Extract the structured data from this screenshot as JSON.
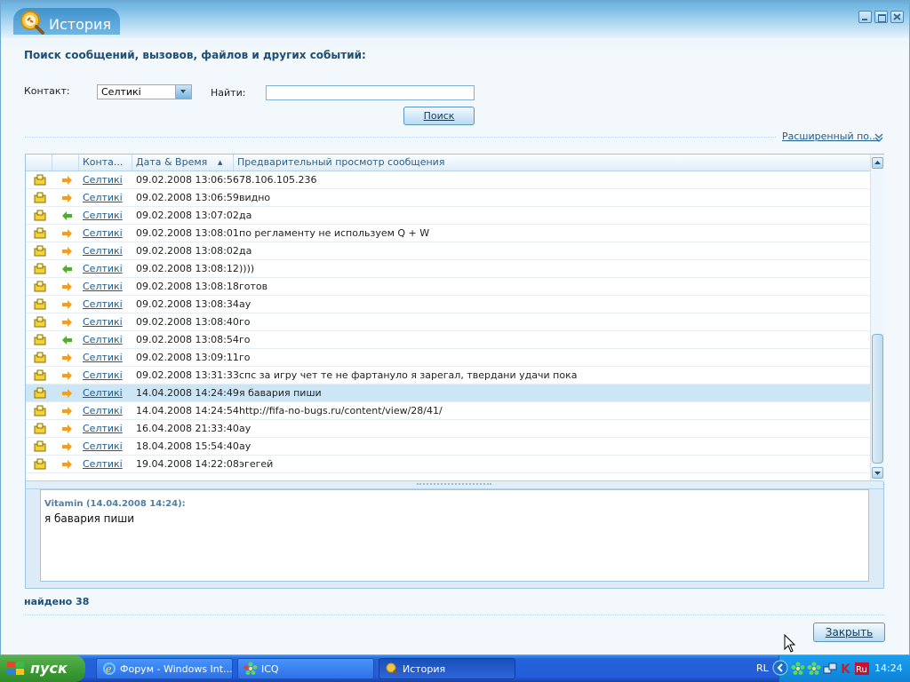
{
  "window": {
    "title": "История",
    "search_heading": "Поиск сообщений, вызовов, файлов и других событий:",
    "contact_label": "Контакт:",
    "contact_value": "Селтикі",
    "find_label": "Найти:",
    "find_value": "",
    "search_button": "Поиск",
    "advanced_link": "Расширенный по...",
    "found_text": "найдено 38",
    "close_button": "Закрыть"
  },
  "table": {
    "columns": [
      "Конта...",
      "Дата & Время",
      "Предварительный просмотр сообщения"
    ],
    "sort_indicator": "▲",
    "rows": [
      {
        "dir": "out",
        "contact": "Селтикі",
        "datetime": "09.02.2008 13:06:56",
        "message": "78.106.105.236"
      },
      {
        "dir": "out",
        "contact": "Селтикі",
        "datetime": "09.02.2008 13:06:59",
        "message": "видно"
      },
      {
        "dir": "in",
        "contact": "Селтикі",
        "datetime": "09.02.2008 13:07:02",
        "message": "да"
      },
      {
        "dir": "out",
        "contact": "Селтикі",
        "datetime": "09.02.2008 13:08:01",
        "message": "по регламенту не используем Q + W"
      },
      {
        "dir": "out",
        "contact": "Селтикі",
        "datetime": "09.02.2008 13:08:02",
        "message": "да"
      },
      {
        "dir": "in",
        "contact": "Селтикі",
        "datetime": "09.02.2008 13:08:12",
        "message": "))))"
      },
      {
        "dir": "out",
        "contact": "Селтикі",
        "datetime": "09.02.2008 13:08:18",
        "message": "готов"
      },
      {
        "dir": "out",
        "contact": "Селтикі",
        "datetime": "09.02.2008 13:08:34",
        "message": "ау"
      },
      {
        "dir": "out",
        "contact": "Селтикі",
        "datetime": "09.02.2008 13:08:40",
        "message": "го"
      },
      {
        "dir": "in",
        "contact": "Селтикі",
        "datetime": "09.02.2008 13:08:54",
        "message": "го"
      },
      {
        "dir": "out",
        "contact": "Селтикі",
        "datetime": "09.02.2008 13:09:11",
        "message": "го"
      },
      {
        "dir": "out",
        "contact": "Селтикі",
        "datetime": "09.02.2008 13:31:33",
        "message": "спс за игру чет те не фартануло я зарегал, твердани удачи пока"
      },
      {
        "dir": "out",
        "contact": "Селтикі",
        "datetime": "14.04.2008 14:24:49",
        "message": "я бавария пиши",
        "selected": true
      },
      {
        "dir": "out",
        "contact": "Селтикі",
        "datetime": "14.04.2008 14:24:54",
        "message": "http://fifa-no-bugs.ru/content/view/28/41/"
      },
      {
        "dir": "out",
        "contact": "Селтикі",
        "datetime": "16.04.2008 21:33:40",
        "message": "ау"
      },
      {
        "dir": "out",
        "contact": "Селтикі",
        "datetime": "18.04.2008 15:54:40",
        "message": "ау"
      },
      {
        "dir": "out",
        "contact": "Селтикі",
        "datetime": "19.04.2008 14:22:08",
        "message": "эгегей"
      }
    ]
  },
  "preview": {
    "sender": "Vitamin (14.04.2008 14:24):",
    "text": "я бавария пиши"
  },
  "taskbar": {
    "start_label": "пуск",
    "tasks": [
      {
        "label": "Форум - Windows Int...",
        "icon": "ie-icon"
      },
      {
        "label": "ICQ",
        "icon": "icq-flower-icon"
      },
      {
        "label": "История",
        "icon": "history-icon",
        "active": true
      }
    ],
    "language": "RL",
    "clock": "14:24"
  },
  "colors": {
    "accent": "#1d5a8e",
    "selected_row": "#cde6f6",
    "outgoing_arrow": "#f0a020",
    "incoming_arrow": "#4caf2a",
    "taskbar": "#245ddb",
    "start_button": "#3b9a33"
  }
}
